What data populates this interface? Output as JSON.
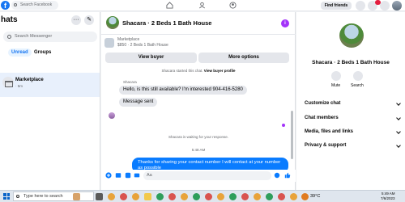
{
  "topbar": {
    "search_placeholder": "Search Facebook",
    "find_friends_label": "Find friends"
  },
  "left": {
    "title": "hats",
    "search_placeholder": "Search Messenger",
    "tabs": [
      "Unread",
      "Groups"
    ],
    "chat": {
      "name": "Marketplace",
      "sub": "· 5m"
    }
  },
  "conversation": {
    "title": "Shacara · 2 Beds 1 Bath House",
    "listing_label": "Marketplace",
    "listing_price": "$850 · 2 Beds 1 Bath House",
    "view_buyer": "View buyer",
    "more_options": "More options",
    "started_text": "Shacara started this chat.",
    "view_buyer_profile": "View buyer profile",
    "sender_name": "Shacara",
    "messages_in": [
      "Hello, is this still available? I'm interested 904-416-5280",
      "Message sent"
    ],
    "waiting_text": "Shacara is waiting for your response.",
    "time": "5:48 AM",
    "message_out": "Thanks for sharing your contact number I will contact at your number as possible",
    "sent_status": "Sent",
    "composer_placeholder": "Aa",
    "accent_color": "#0a7cff"
  },
  "right": {
    "name": "Shacara · 2 Beds 1 Bath House",
    "actions": [
      "Mute",
      "Search"
    ],
    "sections": [
      "Customize chat",
      "Chat members",
      "Media, files and links",
      "Privacy & support"
    ]
  },
  "taskbar": {
    "search_placeholder": "Type here to search",
    "weather": "39°C",
    "time": "5:49 AM",
    "date": "7/6/2023"
  }
}
